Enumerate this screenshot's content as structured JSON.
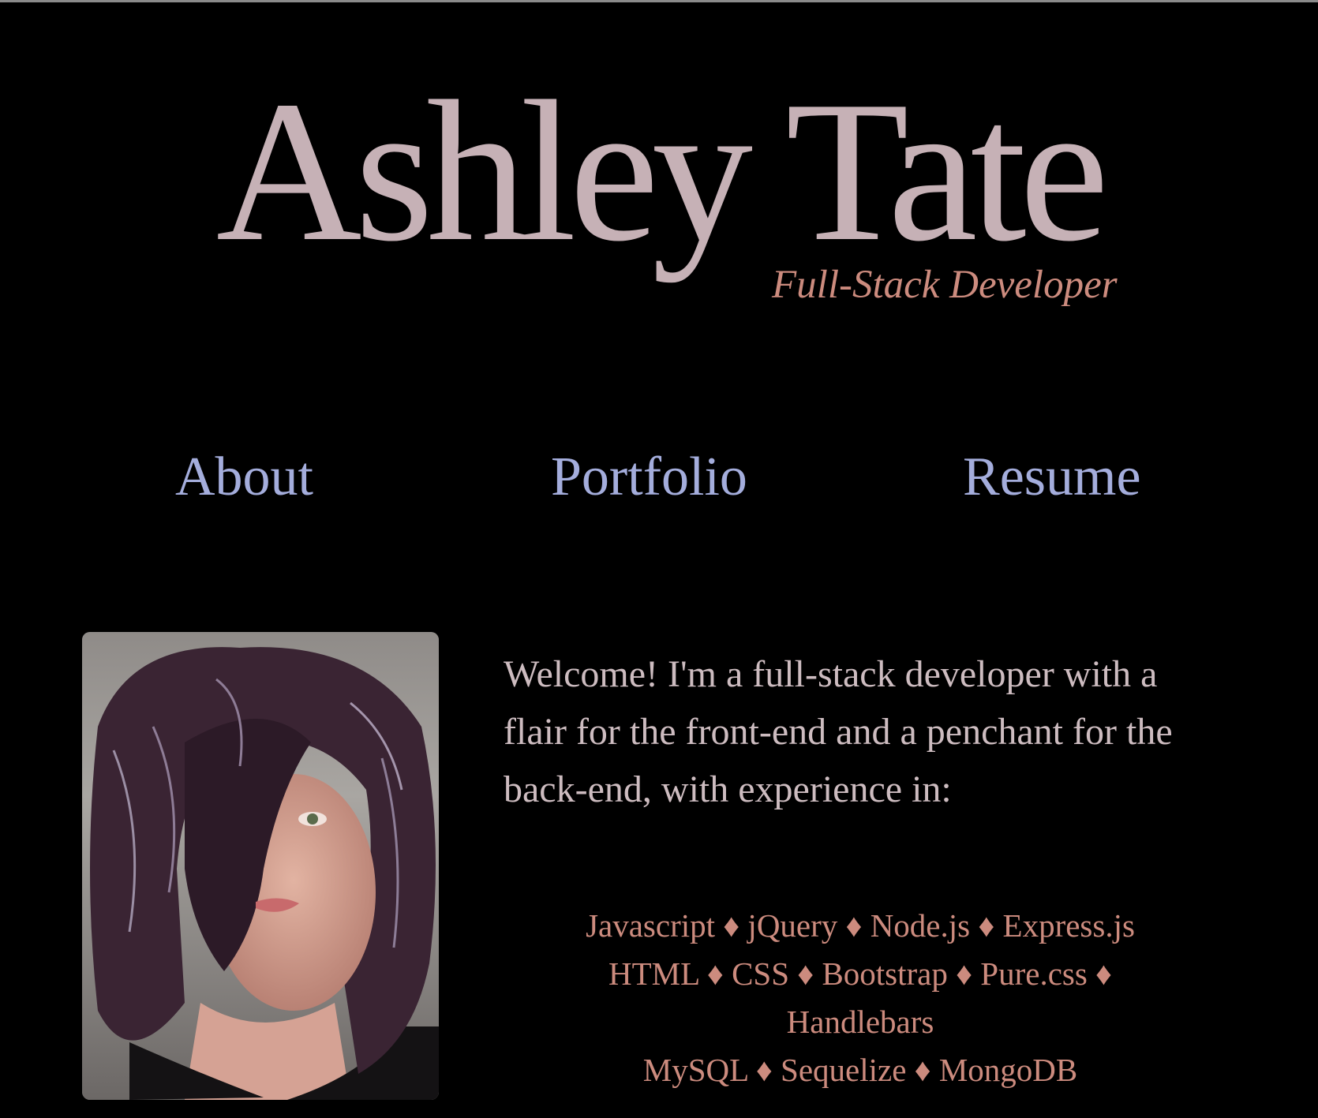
{
  "header": {
    "name": "Ashley Tate",
    "tagline": "Full-Stack Developer"
  },
  "nav": [
    {
      "label": "About"
    },
    {
      "label": "Portfolio"
    },
    {
      "label": "Resume"
    }
  ],
  "profile": {
    "intro": "Welcome! I'm a full-stack developer with a flair for the front-end and a penchant for the back-end, with experience in:",
    "skill_lines": [
      "Javascript ♦ jQuery ♦ Node.js ♦ Express.js",
      "HTML ♦ CSS ♦ Bootstrap ♦ Pure.css ♦",
      "Handlebars",
      "MySQL ♦ Sequelize ♦ MongoDB"
    ]
  },
  "colors": {
    "background": "#000000",
    "name": "#c6b1b6",
    "tagline": "#cc8b7e",
    "nav": "#a4addc",
    "intro": "#cdbcc0",
    "skills": "#cc8b7e"
  }
}
